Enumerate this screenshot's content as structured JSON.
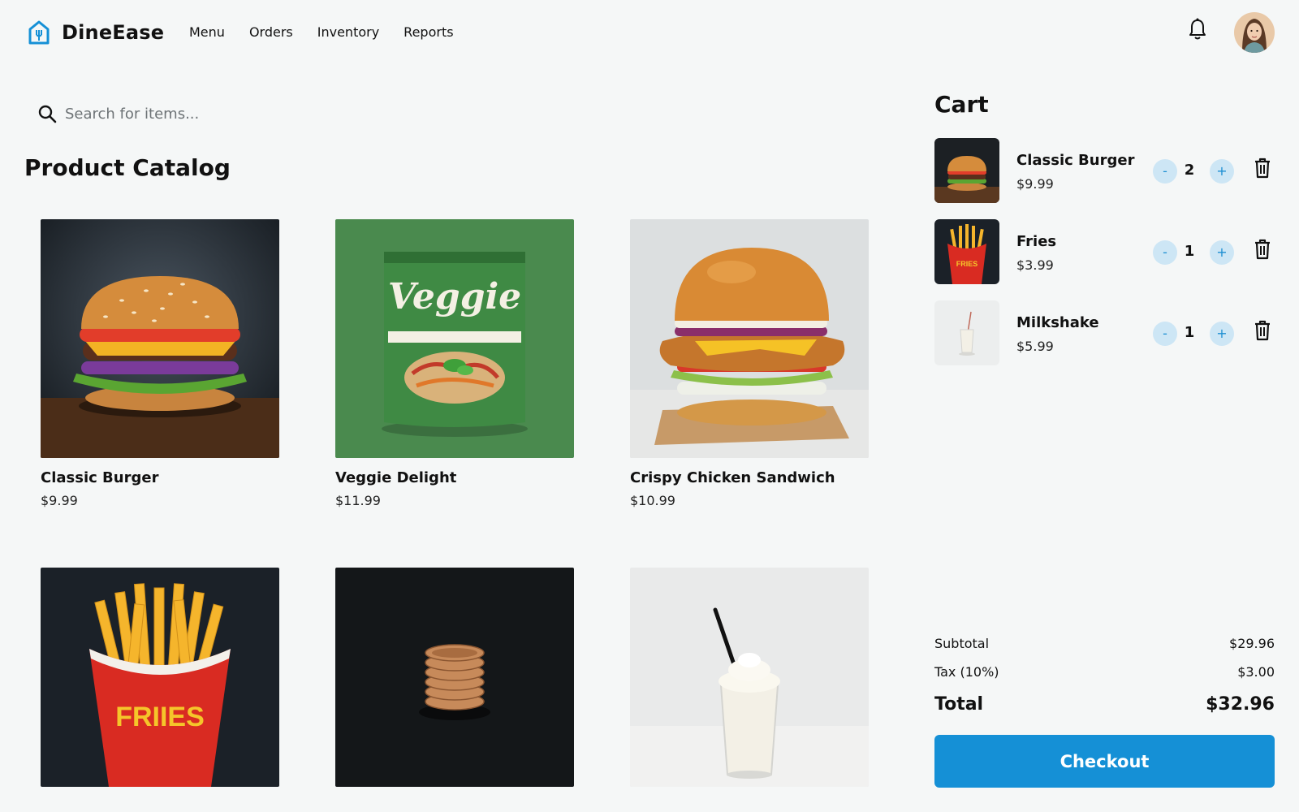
{
  "app": {
    "name": "DineEase",
    "logo_icon": "house-fork-icon"
  },
  "nav": {
    "items": [
      "Menu",
      "Orders",
      "Inventory",
      "Reports"
    ]
  },
  "header": {
    "notification_icon": "bell-icon",
    "avatar_icon": "user-avatar"
  },
  "search": {
    "placeholder": "Search for items...",
    "value": "",
    "icon": "search-icon"
  },
  "catalog": {
    "title": "Product Catalog",
    "products": [
      {
        "name": "Classic Burger",
        "price": "$9.99"
      },
      {
        "name": "Veggie Delight",
        "price": "$11.99"
      },
      {
        "name": "Crispy Chicken Sandwich",
        "price": "$10.99"
      },
      {
        "name": "",
        "price": ""
      },
      {
        "name": "",
        "price": ""
      },
      {
        "name": "",
        "price": ""
      }
    ],
    "image_text": {
      "veggie_pack": "Veggie",
      "fries_box": "FRIIES"
    }
  },
  "cart": {
    "title": "Cart",
    "items": [
      {
        "name": "Classic Burger",
        "price": "$9.99",
        "qty": "2"
      },
      {
        "name": "Fries",
        "price": "$3.99",
        "qty": "1"
      },
      {
        "name": "Milkshake",
        "price": "$5.99",
        "qty": "1"
      }
    ],
    "minus_label": "-",
    "plus_label": "+",
    "subtotal_label": "Subtotal",
    "subtotal": "$29.96",
    "tax_label": "Tax (10%)",
    "tax": "$3.00",
    "total_label": "Total",
    "total": "$32.96",
    "checkout_label": "Checkout",
    "fries_box_text": "FRIES"
  },
  "colors": {
    "accent": "#1590d6",
    "qty_bg": "#cde6f5",
    "background": "#f5f7f7"
  }
}
